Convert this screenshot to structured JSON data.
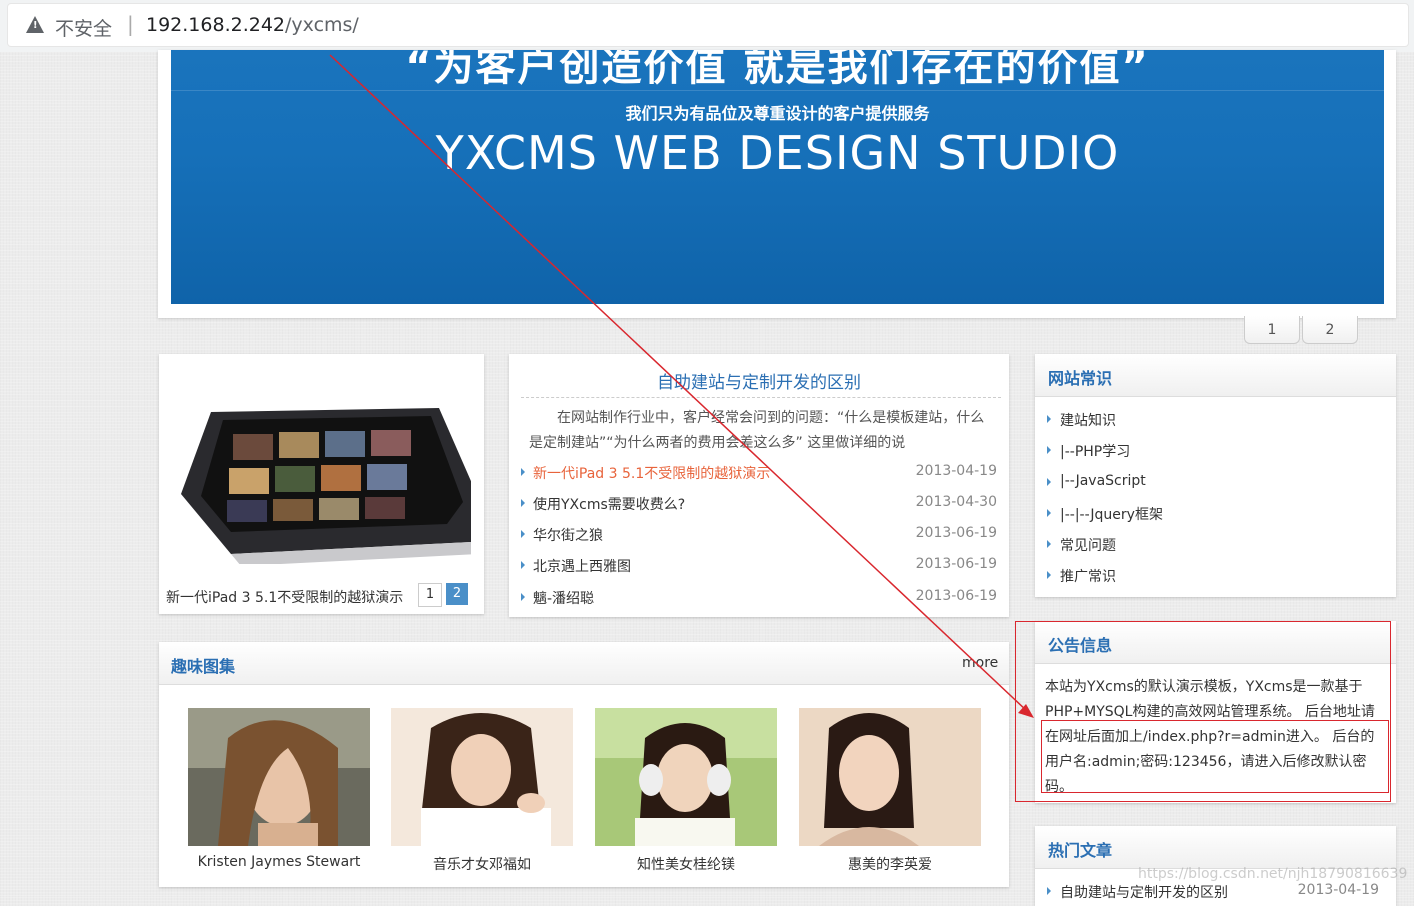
{
  "browser": {
    "security_label": "不安全",
    "separator": "|",
    "url_host": "192.168.2.242",
    "url_path": "/yxcms/"
  },
  "banner": {
    "slogan": "“为客户创造价值  就是我们存在的价值”",
    "subtitle": "我们只为有品位及尊重设计的客户提供服务",
    "title_en": "YXCMS WEB DESIGN STUDIO",
    "pages": [
      "1",
      "2"
    ]
  },
  "product": {
    "caption": "新一代iPad 3 5.1不受限制的越狱演示",
    "pages": [
      "1",
      "2"
    ]
  },
  "news": {
    "title": "自助建站与定制开发的区别",
    "summary": "在网站制作行业中，客户经常会问到的问题：“什么是模板建站，什么是定制建站”“为什么两者的费用会差这么多” 这里做详细的说",
    "items": [
      {
        "title": "新一代iPad 3 5.1不受限制的越狱演示",
        "date": "2013-04-19"
      },
      {
        "title": "使用YXcms需要收费么?",
        "date": "2013-04-30"
      },
      {
        "title": "华尔街之狼",
        "date": "2013-06-19"
      },
      {
        "title": "北京遇上西雅图",
        "date": "2013-06-19"
      },
      {
        "title": "魑-潘绍聪",
        "date": "2013-06-19"
      }
    ]
  },
  "knowledge": {
    "title": "网站常识",
    "items": [
      "建站知识",
      "|--PHP学习",
      "|--JavaScript",
      "|--|--Jquery框架",
      "常见问题",
      "推广常识"
    ]
  },
  "notice": {
    "title": "公告信息",
    "body": "本站为YXcms的默认演示模板，YXcms是一款基于PHP+MYSQL构建的高效网站管理系统。 后台地址请在网址后面加上/index.php?r=admin进入。 后台的用户名:admin;密码:123456，请进入后修改默认密码。"
  },
  "hot": {
    "title": "热门文章",
    "items": [
      {
        "title": "自助建站与定制开发的区别",
        "date": "2013-04-19"
      }
    ]
  },
  "gallery": {
    "title": "趣味图集",
    "more": "more",
    "items": [
      {
        "name": "Kristen Jaymes Stewart"
      },
      {
        "name": "音乐才女邓福如"
      },
      {
        "name": "知性美女桂纶镁"
      },
      {
        "name": "惠美的李英爱"
      }
    ]
  },
  "watermark": "https://blog.csdn.net/njh18790816639",
  "colors": {
    "accent": "#2b6fb3",
    "banner": "#1670b9",
    "highlight": "#d9272e",
    "hot_link": "#e8643c"
  }
}
